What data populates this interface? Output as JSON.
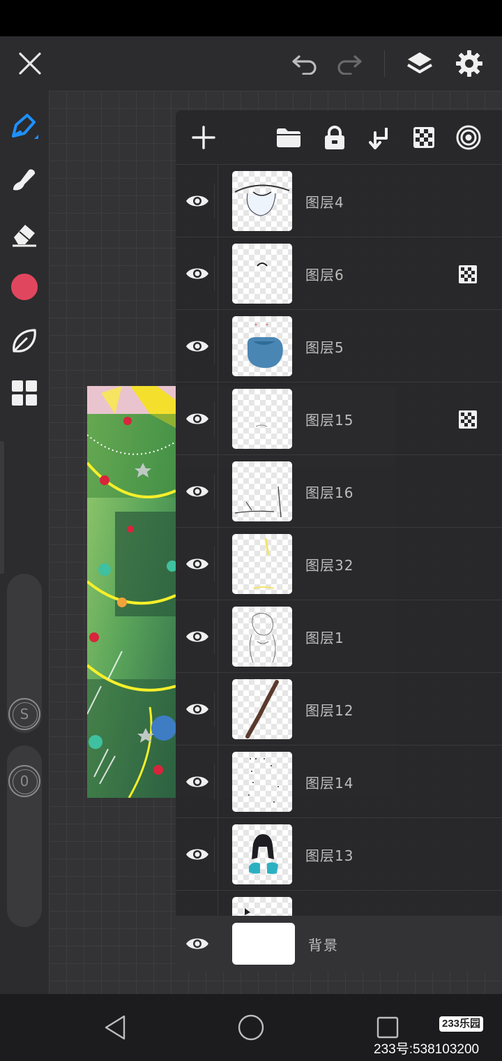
{
  "app": {
    "icons": {
      "close": "close-icon",
      "undo": "undo-icon",
      "redo": "redo-icon",
      "layers": "layers-icon",
      "settings": "gear-icon"
    },
    "current_color": "#e0475e",
    "accent_color": "#1e90ff"
  },
  "left_toolbar": {
    "tools": [
      {
        "id": "pen",
        "icon": "pen-icon",
        "active": true
      },
      {
        "id": "smudge",
        "icon": "smudge-icon",
        "active": false
      },
      {
        "id": "eraser",
        "icon": "eraser-icon",
        "active": false
      },
      {
        "id": "color",
        "icon": "color-swatch-icon",
        "active": false
      },
      {
        "id": "brush-library",
        "icon": "leaf-icon",
        "active": false
      },
      {
        "id": "more",
        "icon": "grid-icon",
        "active": false
      }
    ],
    "size_slider_label": "S",
    "opacity_slider_label": "0"
  },
  "layers_panel": {
    "toolbar_icons": [
      "add-icon",
      "folder-icon",
      "lock-icon",
      "merge-down-icon",
      "alpha-lock-icon",
      "blend-mode-icon"
    ],
    "layers": [
      {
        "name": "图层4",
        "visible": true,
        "alpha_locked": false
      },
      {
        "name": "图层6",
        "visible": true,
        "alpha_locked": true
      },
      {
        "name": "图层5",
        "visible": true,
        "alpha_locked": false
      },
      {
        "name": "图层15",
        "visible": true,
        "alpha_locked": true
      },
      {
        "name": "图层16",
        "visible": true,
        "alpha_locked": false
      },
      {
        "name": "图层32",
        "visible": true,
        "alpha_locked": false
      },
      {
        "name": "图层1",
        "visible": true,
        "alpha_locked": false
      },
      {
        "name": "图层12",
        "visible": true,
        "alpha_locked": false
      },
      {
        "name": "图层14",
        "visible": true,
        "alpha_locked": false
      },
      {
        "name": "图层13",
        "visible": true,
        "alpha_locked": false
      }
    ],
    "background_layer": {
      "name": "背景",
      "visible": true
    }
  },
  "watermark": {
    "badge": "233乐园",
    "id_text": "233号:538103200"
  }
}
